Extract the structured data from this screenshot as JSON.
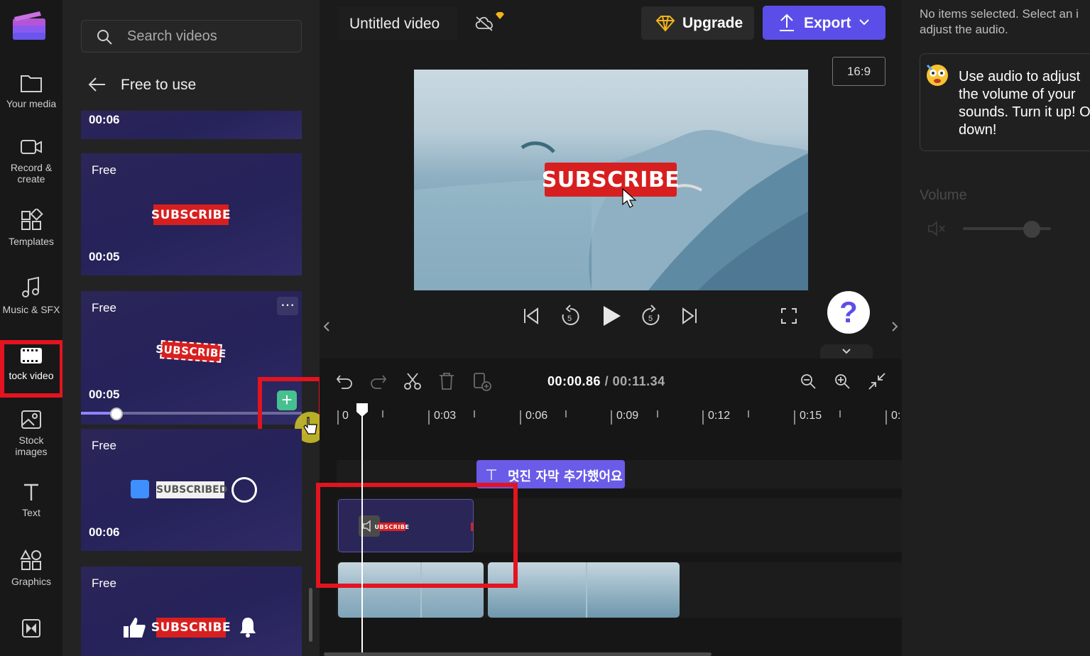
{
  "app": {
    "accent": "#5b4ee8",
    "highlight_color": "#e3141f"
  },
  "rail": {
    "items": [
      {
        "label": "Your media",
        "icon": "folder-icon"
      },
      {
        "label": "Record &\ncreate",
        "icon": "camera-icon"
      },
      {
        "label": "Templates",
        "icon": "templates-icon"
      },
      {
        "label": "Music & SFX",
        "icon": "music-icon"
      },
      {
        "label": "tock video",
        "icon": "film-icon"
      },
      {
        "label": "Stock\nimages",
        "icon": "image-icon"
      },
      {
        "label": "Text",
        "icon": "text-icon"
      },
      {
        "label": "Graphics",
        "icon": "graphics-icon"
      },
      {
        "label": "",
        "icon": "transitions-icon"
      }
    ]
  },
  "library": {
    "search_placeholder": "Search videos",
    "back_title": "Free to use",
    "cards": [
      {
        "free": "",
        "duration": "00:06",
        "badge": ""
      },
      {
        "free": "Free",
        "duration": "00:05",
        "badge": "SUBSCRIBE"
      },
      {
        "free": "Free",
        "duration": "00:05",
        "badge": "SUBSCRIBE"
      },
      {
        "free": "Free",
        "duration": "00:06",
        "badge": "SUBSCRIBED"
      },
      {
        "free": "Free",
        "duration": "",
        "badge": "SUBSCRIBE"
      }
    ],
    "more_label": "⋯",
    "add_label": "+",
    "preview_progress": 0.16
  },
  "header": {
    "title": "Untitled video",
    "upgrade": "Upgrade",
    "export": "Export"
  },
  "preview": {
    "aspect": "16:9",
    "overlay_text": "SUBSCRIBE",
    "help": "?"
  },
  "timeline": {
    "current_time": "00:00.86",
    "separator": " / ",
    "total_time": "00:11.34",
    "ruler": [
      "0",
      "0:03",
      "0:06",
      "0:09",
      "0:12",
      "0:15",
      "0:"
    ],
    "text_clip": "멋진 자막 추가했어요",
    "overlay_clip_text": "UBSCRIBE"
  },
  "rightpanel": {
    "notice": "No items selected. Select an i\nadjust the audio.",
    "tip": "Use audio to adjust\nthe volume of your\nsounds. Turn it up! O\ndown!",
    "volume_label": "Volume",
    "volume_level": 0.78
  }
}
